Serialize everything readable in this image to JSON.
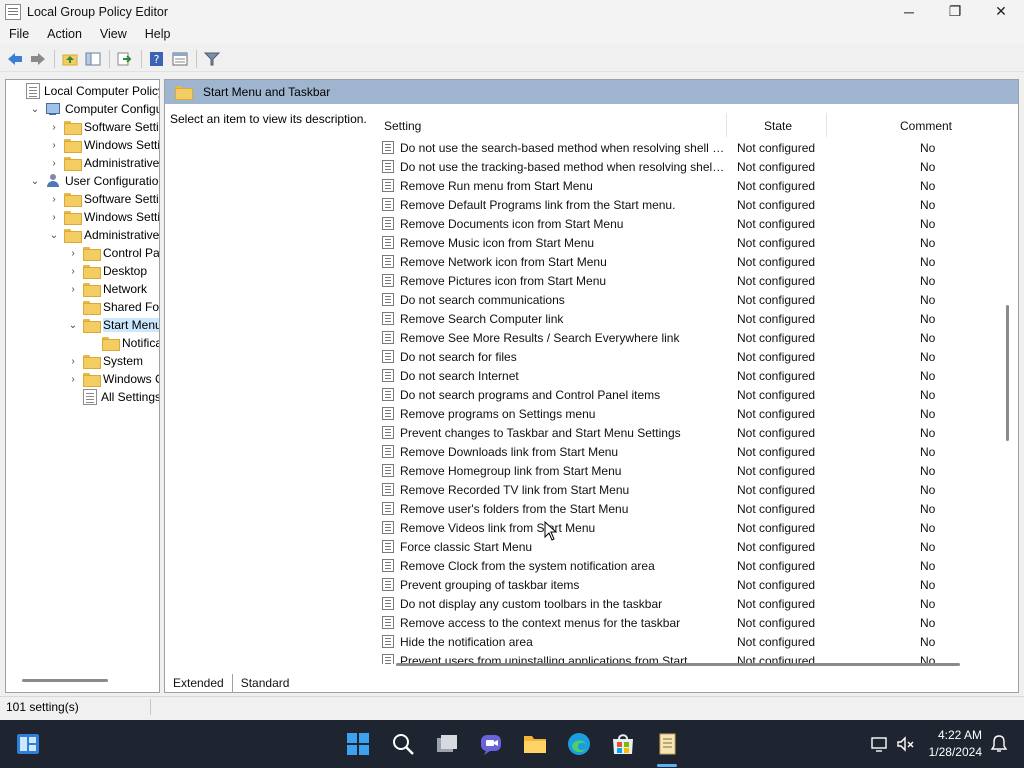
{
  "window": {
    "title": "Local Group Policy Editor",
    "minimize_glyph": "─",
    "maximize_glyph": "❐",
    "close_glyph": "✕"
  },
  "menu": [
    "File",
    "Action",
    "View",
    "Help"
  ],
  "toolbar_icons": [
    "back-arrow-icon",
    "forward-arrow-icon",
    "up-folder-icon",
    "show-hide-tree-icon",
    "export-list-icon",
    "help-icon",
    "properties-icon",
    "filter-icon"
  ],
  "tree": [
    {
      "label": "Local Computer Policy",
      "icon": "docicon",
      "level": 0,
      "expander": ""
    },
    {
      "label": "Computer Configura",
      "icon": "pcicon",
      "level": 1,
      "expander": "expanded"
    },
    {
      "label": "Software Settings",
      "icon": "folder",
      "level": 2,
      "expander": "collapsed"
    },
    {
      "label": "Windows Setting",
      "icon": "folder",
      "level": 2,
      "expander": "collapsed"
    },
    {
      "label": "Administrative Te",
      "icon": "folder",
      "level": 2,
      "expander": "collapsed"
    },
    {
      "label": "User Configuration",
      "icon": "usericon",
      "level": 1,
      "expander": "expanded"
    },
    {
      "label": "Software Settings",
      "icon": "folder",
      "level": 2,
      "expander": "collapsed"
    },
    {
      "label": "Windows Setting",
      "icon": "folder",
      "level": 2,
      "expander": "collapsed"
    },
    {
      "label": "Administrative Te",
      "icon": "folder",
      "level": 2,
      "expander": "expanded"
    },
    {
      "label": "Control Panel",
      "icon": "folder",
      "level": 3,
      "expander": "collapsed"
    },
    {
      "label": "Desktop",
      "icon": "folder",
      "level": 3,
      "expander": "collapsed"
    },
    {
      "label": "Network",
      "icon": "folder",
      "level": 3,
      "expander": "collapsed"
    },
    {
      "label": "Shared Folder",
      "icon": "folder",
      "level": 3,
      "expander": ""
    },
    {
      "label": "Start Menu ar",
      "icon": "folder",
      "level": 3,
      "expander": "expanded",
      "selected": true
    },
    {
      "label": "Notificatio",
      "icon": "folder",
      "level": 4,
      "expander": ""
    },
    {
      "label": "System",
      "icon": "folder",
      "level": 3,
      "expander": "collapsed"
    },
    {
      "label": "Windows Cor",
      "icon": "folder",
      "level": 3,
      "expander": "collapsed"
    },
    {
      "label": "All Settings",
      "icon": "docicon",
      "level": 3,
      "expander": ""
    }
  ],
  "right_header": "Start Menu and Taskbar",
  "description": "Select an item to view its description.",
  "columns": {
    "setting": "Setting",
    "state": "State",
    "comment": "Comment"
  },
  "settings": [
    {
      "name": "Do not use the search-based method when resolving shell s...",
      "state": "Not configured",
      "comment": "No"
    },
    {
      "name": "Do not use the tracking-based method when resolving shell ...",
      "state": "Not configured",
      "comment": "No"
    },
    {
      "name": "Remove Run menu from Start Menu",
      "state": "Not configured",
      "comment": "No"
    },
    {
      "name": "Remove Default Programs link from the Start menu.",
      "state": "Not configured",
      "comment": "No"
    },
    {
      "name": "Remove Documents icon from Start Menu",
      "state": "Not configured",
      "comment": "No"
    },
    {
      "name": "Remove Music icon from Start Menu",
      "state": "Not configured",
      "comment": "No"
    },
    {
      "name": "Remove Network icon from Start Menu",
      "state": "Not configured",
      "comment": "No"
    },
    {
      "name": "Remove Pictures icon from Start Menu",
      "state": "Not configured",
      "comment": "No"
    },
    {
      "name": "Do not search communications",
      "state": "Not configured",
      "comment": "No"
    },
    {
      "name": "Remove Search Computer link",
      "state": "Not configured",
      "comment": "No"
    },
    {
      "name": "Remove See More Results / Search Everywhere link",
      "state": "Not configured",
      "comment": "No"
    },
    {
      "name": "Do not search for files",
      "state": "Not configured",
      "comment": "No"
    },
    {
      "name": "Do not search Internet",
      "state": "Not configured",
      "comment": "No"
    },
    {
      "name": "Do not search programs and Control Panel items",
      "state": "Not configured",
      "comment": "No"
    },
    {
      "name": "Remove programs on Settings menu",
      "state": "Not configured",
      "comment": "No"
    },
    {
      "name": "Prevent changes to Taskbar and Start Menu Settings",
      "state": "Not configured",
      "comment": "No"
    },
    {
      "name": "Remove Downloads link from Start Menu",
      "state": "Not configured",
      "comment": "No"
    },
    {
      "name": "Remove Homegroup link from Start Menu",
      "state": "Not configured",
      "comment": "No"
    },
    {
      "name": "Remove Recorded TV link from Start Menu",
      "state": "Not configured",
      "comment": "No"
    },
    {
      "name": "Remove user's folders from the Start Menu",
      "state": "Not configured",
      "comment": "No"
    },
    {
      "name": "Remove Videos link from Start Menu",
      "state": "Not configured",
      "comment": "No"
    },
    {
      "name": "Force classic Start Menu",
      "state": "Not configured",
      "comment": "No"
    },
    {
      "name": "Remove Clock from the system notification area",
      "state": "Not configured",
      "comment": "No"
    },
    {
      "name": "Prevent grouping of taskbar items",
      "state": "Not configured",
      "comment": "No"
    },
    {
      "name": "Do not display any custom toolbars in the taskbar",
      "state": "Not configured",
      "comment": "No"
    },
    {
      "name": "Remove access to the context menus for the taskbar",
      "state": "Not configured",
      "comment": "No"
    },
    {
      "name": "Hide the notification area",
      "state": "Not configured",
      "comment": "No"
    },
    {
      "name": "Prevent users from uninstalling applications from Start",
      "state": "Not configured",
      "comment": "No"
    }
  ],
  "tabs": {
    "extended": "Extended",
    "standard": "Standard"
  },
  "status": "101 setting(s)",
  "taskbar": {
    "apps": [
      "widgets-icon",
      "start-icon",
      "search-icon",
      "task-view-icon",
      "teams-chat-icon",
      "file-explorer-icon",
      "edge-icon",
      "store-icon",
      "group-policy-editor-icon"
    ],
    "time": "4:22 AM",
    "date": "1/28/2024"
  }
}
